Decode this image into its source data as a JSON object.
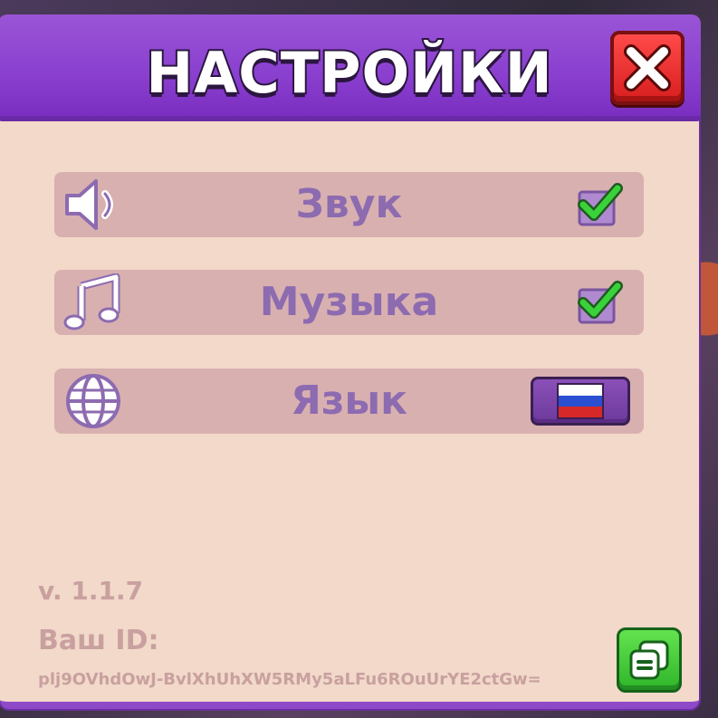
{
  "dialog": {
    "title": "НАСТРОЙКИ",
    "close_icon": "close-x-icon"
  },
  "settings": [
    {
      "label": "Звук",
      "icon": "speaker-icon",
      "control": "checkbox",
      "checked": true
    },
    {
      "label": "Музыка",
      "icon": "music-note-icon",
      "control": "checkbox",
      "checked": true
    },
    {
      "label": "Язык",
      "icon": "globe-icon",
      "control": "language-button",
      "flag": "russia-flag-icon"
    }
  ],
  "footer": {
    "version": "v. 1.1.7",
    "id_label": "Ваш ID:",
    "id_value": "plj9OVhdOwJ-BvlXhUhXW5RMy5aLFu6ROuUrYE2ctGw=",
    "copy_icon": "copy-icon"
  },
  "colors": {
    "header": "#8a3fcf",
    "panel": "#f2d9c9",
    "row": "#d8b0b0",
    "label": "#8d6bb0",
    "close": "#e02020",
    "check": "#3ad23a",
    "copy": "#3cc83a"
  }
}
